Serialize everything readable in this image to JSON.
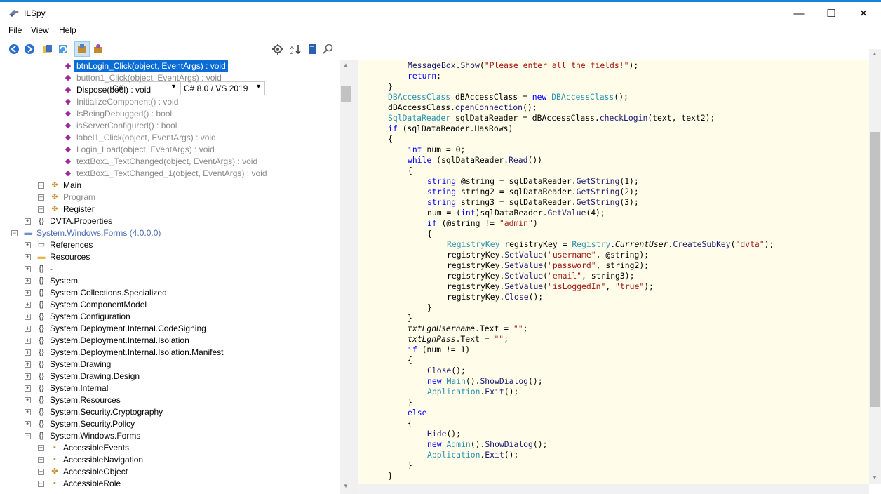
{
  "window": {
    "title": "ILSpy",
    "minimize_glyph": "—",
    "maximize_glyph": "☐",
    "close_glyph": "✕"
  },
  "menu": [
    "File",
    "View",
    "Help"
  ],
  "toolbar": {
    "language": "C#",
    "version": "C# 8.0 / VS 2019",
    "icons": [
      "back-icon",
      "forward-icon",
      "open-icon",
      "refresh-icon",
      "show-private-icon",
      "show-compiler-generated-icon",
      "settings-icon",
      "sort-icon",
      "book-icon",
      "search-icon"
    ]
  },
  "colors": {
    "accent": "#1883d7",
    "selection": "#0a6cd6",
    "code_bg": "#fffdea",
    "keyword": "#0000ff",
    "type": "#2b91af",
    "string": "#a31515"
  },
  "tree": [
    {
      "label": "btnLogin_Click(object, EventArgs) : void",
      "indent": 5,
      "icon": "method-icon",
      "selected": true,
      "style": "normal",
      "expander": ""
    },
    {
      "label": "button1_Click(object, EventArgs) : void",
      "indent": 5,
      "icon": "method-icon",
      "style": "gray",
      "expander": ""
    },
    {
      "label": "Dispose(bool) : void",
      "indent": 5,
      "icon": "method-icon",
      "style": "normal",
      "expander": ""
    },
    {
      "label": "InitializeComponent() : void",
      "indent": 5,
      "icon": "method-icon",
      "style": "gray",
      "expander": ""
    },
    {
      "label": "IsBeingDebugged() : bool",
      "indent": 5,
      "icon": "method-icon",
      "style": "gray",
      "expander": ""
    },
    {
      "label": "isServerConfigured() : bool",
      "indent": 5,
      "icon": "method-icon",
      "style": "gray",
      "expander": ""
    },
    {
      "label": "label1_Click(object, EventArgs) : void",
      "indent": 5,
      "icon": "method-icon",
      "style": "gray",
      "expander": ""
    },
    {
      "label": "Login_Load(object, EventArgs) : void",
      "indent": 5,
      "icon": "method-icon",
      "style": "gray",
      "expander": ""
    },
    {
      "label": "textBox1_TextChanged(object, EventArgs) : void",
      "indent": 5,
      "icon": "method-icon",
      "style": "gray",
      "expander": ""
    },
    {
      "label": "textBox1_TextChanged_1(object, EventArgs) : void",
      "indent": 5,
      "icon": "method-icon",
      "style": "gray",
      "expander": ""
    },
    {
      "label": "Main",
      "indent": 4,
      "icon": "class-icon",
      "style": "normal",
      "expander": "+"
    },
    {
      "label": "Program",
      "indent": 4,
      "icon": "class-icon",
      "style": "gray",
      "expander": "+"
    },
    {
      "label": "Register",
      "indent": 4,
      "icon": "class-icon",
      "style": "normal",
      "expander": "+"
    },
    {
      "label": "DVTA.Properties",
      "indent": 3,
      "icon": "namespace-icon",
      "style": "normal",
      "expander": "+"
    },
    {
      "label": "System.Windows.Forms (4.0.0.0)",
      "indent": 2,
      "icon": "assembly-icon",
      "style": "blue",
      "expander": "−"
    },
    {
      "label": "References",
      "indent": 3,
      "icon": "references-icon",
      "style": "normal",
      "expander": "+"
    },
    {
      "label": "Resources",
      "indent": 3,
      "icon": "folder-icon",
      "style": "normal",
      "expander": "+"
    },
    {
      "label": "-",
      "indent": 3,
      "icon": "namespace-icon",
      "style": "normal",
      "expander": "+"
    },
    {
      "label": "System",
      "indent": 3,
      "icon": "namespace-icon",
      "style": "normal",
      "expander": "+"
    },
    {
      "label": "System.Collections.Specialized",
      "indent": 3,
      "icon": "namespace-icon",
      "style": "normal",
      "expander": "+"
    },
    {
      "label": "System.ComponentModel",
      "indent": 3,
      "icon": "namespace-icon",
      "style": "normal",
      "expander": "+"
    },
    {
      "label": "System.Configuration",
      "indent": 3,
      "icon": "namespace-icon",
      "style": "normal",
      "expander": "+"
    },
    {
      "label": "System.Deployment.Internal.CodeSigning",
      "indent": 3,
      "icon": "namespace-icon",
      "style": "normal",
      "expander": "+"
    },
    {
      "label": "System.Deployment.Internal.Isolation",
      "indent": 3,
      "icon": "namespace-icon",
      "style": "normal",
      "expander": "+"
    },
    {
      "label": "System.Deployment.Internal.Isolation.Manifest",
      "indent": 3,
      "icon": "namespace-icon",
      "style": "normal",
      "expander": "+"
    },
    {
      "label": "System.Drawing",
      "indent": 3,
      "icon": "namespace-icon",
      "style": "normal",
      "expander": "+"
    },
    {
      "label": "System.Drawing.Design",
      "indent": 3,
      "icon": "namespace-icon",
      "style": "normal",
      "expander": "+"
    },
    {
      "label": "System.Internal",
      "indent": 3,
      "icon": "namespace-icon",
      "style": "normal",
      "expander": "+"
    },
    {
      "label": "System.Resources",
      "indent": 3,
      "icon": "namespace-icon",
      "style": "normal",
      "expander": "+"
    },
    {
      "label": "System.Security.Cryptography",
      "indent": 3,
      "icon": "namespace-icon",
      "style": "normal",
      "expander": "+"
    },
    {
      "label": "System.Security.Policy",
      "indent": 3,
      "icon": "namespace-icon",
      "style": "normal",
      "expander": "+"
    },
    {
      "label": "System.Windows.Forms",
      "indent": 3,
      "icon": "namespace-icon",
      "style": "normal",
      "expander": "−"
    },
    {
      "label": "AccessibleEvents",
      "indent": 4,
      "icon": "enum-icon",
      "style": "normal",
      "expander": "+"
    },
    {
      "label": "AccessibleNavigation",
      "indent": 4,
      "icon": "enum-icon",
      "style": "normal",
      "expander": "+"
    },
    {
      "label": "AccessibleObject",
      "indent": 4,
      "icon": "class-icon",
      "style": "normal",
      "expander": "+"
    },
    {
      "label": "AccessibleRole",
      "indent": 4,
      "icon": "enum-icon",
      "style": "normal",
      "expander": "+"
    }
  ],
  "code": [
    [
      [
        2,
        ""
      ],
      [
        "mt",
        "MessageBox"
      ],
      [
        "",
        "."
      ],
      [
        "mt",
        "Show"
      ],
      [
        "",
        "("
      ],
      [
        "st",
        "\"Please enter all the fields!\""
      ],
      [
        "",
        ");"
      ]
    ],
    [
      [
        2,
        ""
      ],
      [
        "kw",
        "return"
      ],
      [
        "",
        ";"
      ]
    ],
    [
      [
        1,
        ""
      ],
      [
        "",
        "}"
      ]
    ],
    [
      [
        1,
        ""
      ],
      [
        "ty",
        "DBAccessClass"
      ],
      [
        "",
        " dBAccessClass = "
      ],
      [
        "kw",
        "new"
      ],
      [
        "",
        " "
      ],
      [
        "ty",
        "DBAccessClass"
      ],
      [
        "",
        "();"
      ]
    ],
    [
      [
        1,
        ""
      ],
      [
        "",
        "dBAccessClass."
      ],
      [
        "mt",
        "openConnection"
      ],
      [
        "",
        "();"
      ]
    ],
    [
      [
        1,
        ""
      ],
      [
        "ty",
        "SqlDataReader"
      ],
      [
        "",
        " sqlDataReader = dBAccessClass."
      ],
      [
        "mt",
        "checkLogin"
      ],
      [
        "",
        "(text, text2);"
      ]
    ],
    [
      [
        1,
        ""
      ],
      [
        "kw",
        "if"
      ],
      [
        "",
        " (sqlDataReader.HasRows)"
      ]
    ],
    [
      [
        1,
        ""
      ],
      [
        "",
        "{"
      ]
    ],
    [
      [
        2,
        ""
      ],
      [
        "kw",
        "int"
      ],
      [
        "",
        " num = 0;"
      ]
    ],
    [
      [
        2,
        ""
      ],
      [
        "kw",
        "while"
      ],
      [
        "",
        " (sqlDataReader."
      ],
      [
        "mt",
        "Read"
      ],
      [
        "",
        "())"
      ]
    ],
    [
      [
        2,
        ""
      ],
      [
        "",
        "{"
      ]
    ],
    [
      [
        3,
        ""
      ],
      [
        "kw",
        "string"
      ],
      [
        "",
        " @string = sqlDataReader."
      ],
      [
        "mt",
        "GetString"
      ],
      [
        "",
        "(1);"
      ]
    ],
    [
      [
        3,
        ""
      ],
      [
        "kw",
        "string"
      ],
      [
        "",
        " string2 = sqlDataReader."
      ],
      [
        "mt",
        "GetString"
      ],
      [
        "",
        "(2);"
      ]
    ],
    [
      [
        3,
        ""
      ],
      [
        "kw",
        "string"
      ],
      [
        "",
        " string3 = sqlDataReader."
      ],
      [
        "mt",
        "GetString"
      ],
      [
        "",
        "(3);"
      ]
    ],
    [
      [
        3,
        ""
      ],
      [
        "",
        "num = ("
      ],
      [
        "kw",
        "int"
      ],
      [
        "",
        ")sqlDataReader."
      ],
      [
        "mt",
        "GetValue"
      ],
      [
        "",
        "(4);"
      ]
    ],
    [
      [
        3,
        ""
      ],
      [
        "kw",
        "if"
      ],
      [
        "",
        " (@string != "
      ],
      [
        "st",
        "\"admin\""
      ],
      [
        "",
        ")"
      ]
    ],
    [
      [
        3,
        ""
      ],
      [
        "",
        "{"
      ]
    ],
    [
      [
        4,
        ""
      ],
      [
        "ty",
        "RegistryKey"
      ],
      [
        "",
        " registryKey = "
      ],
      [
        "ty",
        "Registry"
      ],
      [
        "",
        "."
      ],
      [
        "it",
        "CurrentUser"
      ],
      [
        "",
        "."
      ],
      [
        "mt",
        "CreateSubKey"
      ],
      [
        "",
        "("
      ],
      [
        "st",
        "\"dvta\""
      ],
      [
        "",
        ");"
      ]
    ],
    [
      [
        4,
        ""
      ],
      [
        "",
        "registryKey."
      ],
      [
        "mt",
        "SetValue"
      ],
      [
        "",
        "("
      ],
      [
        "st",
        "\"username\""
      ],
      [
        "",
        ", @string);"
      ]
    ],
    [
      [
        4,
        ""
      ],
      [
        "",
        "registryKey."
      ],
      [
        "mt",
        "SetValue"
      ],
      [
        "",
        "("
      ],
      [
        "st",
        "\"password\""
      ],
      [
        "",
        ", string2);"
      ]
    ],
    [
      [
        4,
        ""
      ],
      [
        "",
        "registryKey."
      ],
      [
        "mt",
        "SetValue"
      ],
      [
        "",
        "("
      ],
      [
        "st",
        "\"email\""
      ],
      [
        "",
        ", string3);"
      ]
    ],
    [
      [
        4,
        ""
      ],
      [
        "",
        "registryKey."
      ],
      [
        "mt",
        "SetValue"
      ],
      [
        "",
        "("
      ],
      [
        "st",
        "\"isLoggedIn\""
      ],
      [
        "",
        ", "
      ],
      [
        "st",
        "\"true\""
      ],
      [
        "",
        ");"
      ]
    ],
    [
      [
        4,
        ""
      ],
      [
        "",
        "registryKey."
      ],
      [
        "mt",
        "Close"
      ],
      [
        "",
        "();"
      ]
    ],
    [
      [
        3,
        ""
      ],
      [
        "",
        "}"
      ]
    ],
    [
      [
        2,
        ""
      ],
      [
        "",
        "}"
      ]
    ],
    [
      [
        2,
        ""
      ],
      [
        "it",
        "txtLgnUsername"
      ],
      [
        "",
        ".Text = "
      ],
      [
        "st",
        "\"\""
      ],
      [
        "",
        ";"
      ]
    ],
    [
      [
        2,
        ""
      ],
      [
        "it",
        "txtLgnPass"
      ],
      [
        "",
        ".Text = "
      ],
      [
        "st",
        "\"\""
      ],
      [
        "",
        ";"
      ]
    ],
    [
      [
        2,
        ""
      ],
      [
        "kw",
        "if"
      ],
      [
        "",
        " (num != 1)"
      ]
    ],
    [
      [
        2,
        ""
      ],
      [
        "",
        "{"
      ]
    ],
    [
      [
        3,
        ""
      ],
      [
        "mt",
        "Close"
      ],
      [
        "",
        "();"
      ]
    ],
    [
      [
        3,
        ""
      ],
      [
        "kw",
        "new"
      ],
      [
        "",
        " "
      ],
      [
        "ty",
        "Main"
      ],
      [
        "",
        "()."
      ],
      [
        "mt",
        "ShowDialog"
      ],
      [
        "",
        "();"
      ]
    ],
    [
      [
        3,
        ""
      ],
      [
        "ty",
        "Application"
      ],
      [
        "",
        "."
      ],
      [
        "mt",
        "Exit"
      ],
      [
        "",
        "();"
      ]
    ],
    [
      [
        2,
        ""
      ],
      [
        "",
        "}"
      ]
    ],
    [
      [
        2,
        ""
      ],
      [
        "kw",
        "else"
      ]
    ],
    [
      [
        2,
        ""
      ],
      [
        "",
        "{"
      ]
    ],
    [
      [
        3,
        ""
      ],
      [
        "mt",
        "Hide"
      ],
      [
        "",
        "();"
      ]
    ],
    [
      [
        3,
        ""
      ],
      [
        "kw",
        "new"
      ],
      [
        "",
        " "
      ],
      [
        "ty",
        "Admin"
      ],
      [
        "",
        "()."
      ],
      [
        "mt",
        "ShowDialog"
      ],
      [
        "",
        "();"
      ]
    ],
    [
      [
        3,
        ""
      ],
      [
        "ty",
        "Application"
      ],
      [
        "",
        "."
      ],
      [
        "mt",
        "Exit"
      ],
      [
        "",
        "();"
      ]
    ],
    [
      [
        2,
        ""
      ],
      [
        "",
        "}"
      ]
    ],
    [
      [
        1,
        ""
      ],
      [
        "",
        "}"
      ]
    ]
  ]
}
